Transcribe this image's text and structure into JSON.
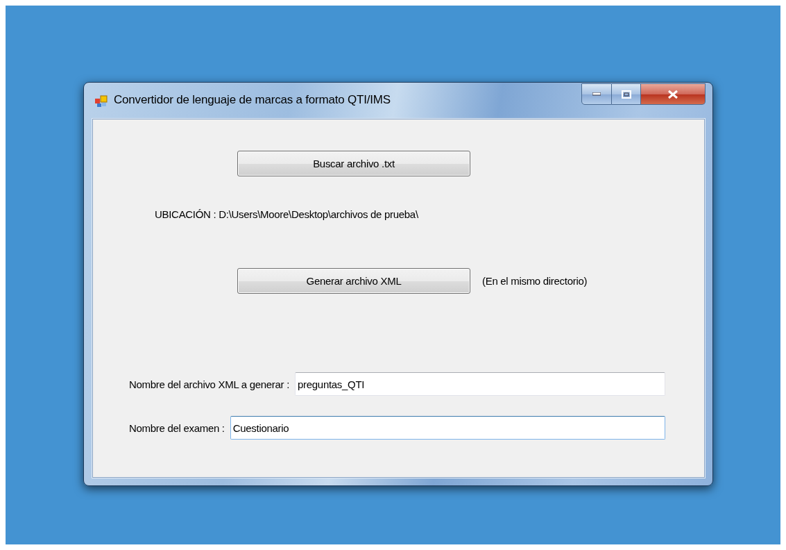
{
  "window": {
    "title": "Convertidor de lenguaje de marcas a formato QTI/IMS"
  },
  "browse_button": {
    "label": "Buscar archivo .txt"
  },
  "location": "UBICACIÓN : D:\\Users\\Moore\\Desktop\\archivos de prueba\\",
  "generate_button": {
    "label": "Generar archivo XML"
  },
  "generate_note": "(En el mismo directorio)",
  "fields": [
    {
      "label": "Nombre del archivo XML a generar :",
      "value": "preguntas_QTI",
      "focused": false
    },
    {
      "label": "Nombre del examen :",
      "value": "Cuestionario",
      "focused": true
    }
  ]
}
